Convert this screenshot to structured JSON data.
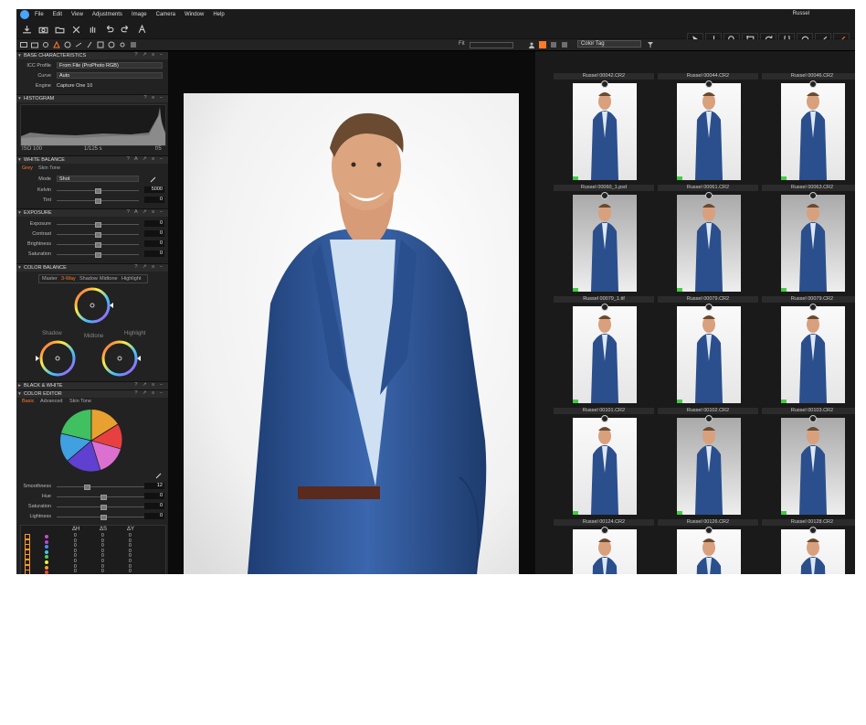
{
  "app": {
    "title": "Russel"
  },
  "menu": [
    "File",
    "Edit",
    "View",
    "Adjustments",
    "Image",
    "Camera",
    "Window",
    "Help"
  ],
  "viewer": {
    "fit_label": "Fit"
  },
  "browser": {
    "filter_value": "Color Tag"
  },
  "panels": {
    "base": {
      "title": "BASE CHARACTERISTICS",
      "rows": [
        {
          "label": "ICC Profile",
          "value": "From File (ProPhoto RGB)"
        },
        {
          "label": "Curve",
          "value": "Auto"
        },
        {
          "label": "Engine",
          "value": "Capture One 10"
        }
      ]
    },
    "histogram": {
      "title": "HISTOGRAM",
      "iso": "ISO 100",
      "shutter": "1/125 s",
      "aperture": "f/5"
    },
    "white_balance": {
      "title": "WHITE BALANCE",
      "tabs": [
        "Grey",
        "Skin Tone"
      ],
      "mode_label": "Mode",
      "mode_value": "Shot",
      "rows": [
        {
          "label": "Kelvin",
          "value": "5000"
        },
        {
          "label": "Tint",
          "value": "0"
        }
      ]
    },
    "exposure": {
      "title": "EXPOSURE",
      "rows": [
        {
          "label": "Exposure",
          "value": "0"
        },
        {
          "label": "Contrast",
          "value": "0"
        },
        {
          "label": "Brightness",
          "value": "0"
        },
        {
          "label": "Saturation",
          "value": "0"
        }
      ]
    },
    "color_balance": {
      "title": "COLOR BALANCE",
      "tabs": [
        "Master",
        "3-Way",
        "Shadow",
        "Midtone",
        "Highlight"
      ],
      "wheel_labels": [
        "Shadow",
        "Midtone",
        "Highlight"
      ]
    },
    "bw": {
      "title": "BLACK & WHITE"
    },
    "color_editor": {
      "title": "COLOR EDITOR",
      "tabs": [
        "Basic",
        "Advanced",
        "Skin Tone"
      ],
      "rows": [
        {
          "label": "Smoothness",
          "value": "12"
        },
        {
          "label": "Hue",
          "value": "0"
        },
        {
          "label": "Saturation",
          "value": "0"
        },
        {
          "label": "Lightness",
          "value": "0"
        }
      ],
      "table_headers": [
        "ΔH",
        "ΔS",
        "ΔY"
      ],
      "table_dot_colors": [
        "#c34fd4",
        "#b14ad1",
        "#4a8df2",
        "#47c3ef",
        "#4fd14f",
        "#eeee44",
        "#f0a030",
        "#ef4444"
      ],
      "table_value": "0"
    }
  },
  "thumbnails": [
    {
      "label": "Russel 00042.CR2"
    },
    {
      "label": "Russel 00044.CR2"
    },
    {
      "label": "Russel 00046.CR2"
    },
    {
      "label": "Russel 00060_1.psd"
    },
    {
      "label": "Russel 00061.CR2"
    },
    {
      "label": "Russel 00063.CR2"
    },
    {
      "label": "Russel 00079_1.tif"
    },
    {
      "label": "Russel 00079.CR2"
    },
    {
      "label": "Russel 00079.CR2"
    },
    {
      "label": "Russel 00101.CR2"
    },
    {
      "label": "Russel 00102.CR2"
    },
    {
      "label": "Russel 00103.CR2"
    },
    {
      "label": "Russel 00124.CR2"
    },
    {
      "label": "Russel 00126.CR2"
    },
    {
      "label": "Russel 00128.CR2"
    }
  ],
  "colors": {
    "accent": "#ff7a2a",
    "suit": "#2b4f8c",
    "skin": "#d8a07d"
  }
}
